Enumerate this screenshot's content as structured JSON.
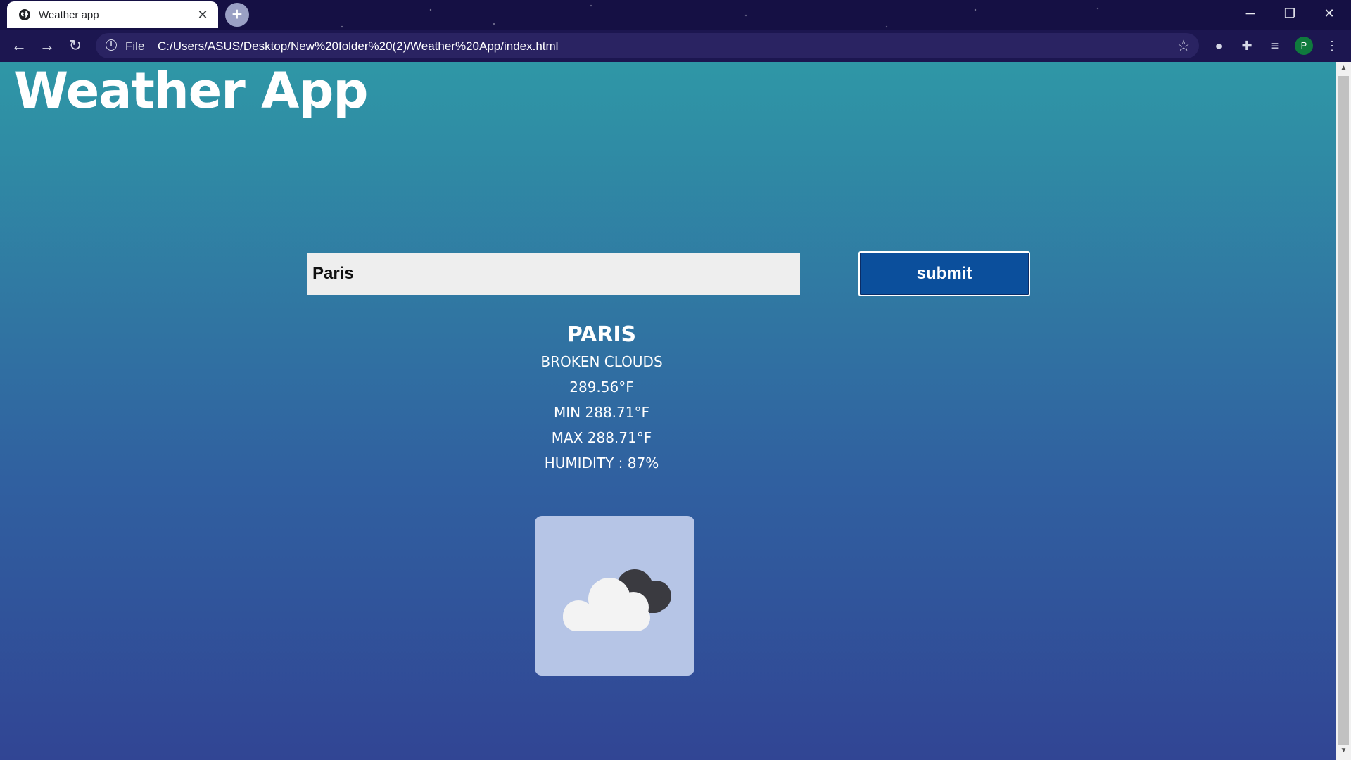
{
  "browser": {
    "tab_title": "Weather app",
    "tab_close": "✕",
    "new_tab": "+",
    "scheme_label": "File",
    "url": "C:/Users/ASUS/Desktop/New%20folder%20(2)/Weather%20App/index.html",
    "profile_initial": "P",
    "window_minimize": "─",
    "window_restore": "❐",
    "window_close": "✕"
  },
  "page": {
    "title": "Weather App",
    "search": {
      "value": "Paris",
      "placeholder": ""
    },
    "submit_label": "submit",
    "weather": {
      "city": "PARIS",
      "description": "BROKEN CLOUDS",
      "temperature": "289.56°F",
      "min": "MIN 288.71°F",
      "max": "MAX 288.71°F",
      "humidity": "HUMIDITY : 87%"
    },
    "icon": "broken-clouds-icon"
  },
  "colors": {
    "gradient_top": "#2f97a6",
    "gradient_bottom": "#314594",
    "submit_bg": "#0b4f9c",
    "icon_card_bg": "#b6c5e6"
  }
}
